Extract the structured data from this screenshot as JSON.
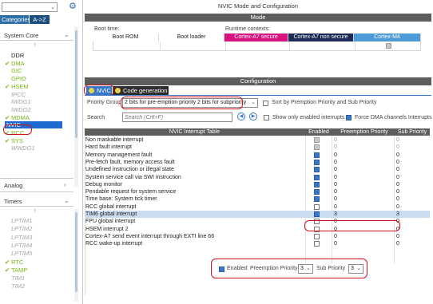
{
  "left": {
    "tabs": {
      "categories": "Categories",
      "az": "A->Z"
    },
    "section_system_core": "System Core",
    "items": [
      {
        "label": "DDR",
        "state": "normal",
        "check": false
      },
      {
        "label": "DMA",
        "state": "green",
        "check": true
      },
      {
        "label": "GIC",
        "state": "green",
        "check": false
      },
      {
        "label": "GPIO",
        "state": "green",
        "check": false
      },
      {
        "label": "HSEM",
        "state": "green",
        "check": true
      },
      {
        "label": "IPCC",
        "state": "gray",
        "check": false
      },
      {
        "label": "IWDG1",
        "state": "gray",
        "check": false
      },
      {
        "label": "IWDG2",
        "state": "gray",
        "check": false
      },
      {
        "label": "MDMA",
        "state": "green",
        "check": true
      },
      {
        "label": "NVIC",
        "state": "selected",
        "check": false
      },
      {
        "label": "RCC",
        "state": "green",
        "check": true
      },
      {
        "label": "SYS",
        "state": "green",
        "check": true
      },
      {
        "label": "WWDG1",
        "state": "gray",
        "check": false
      }
    ],
    "section_analog": "Analog",
    "section_timers": "Timers",
    "timers": [
      {
        "label": "LPTIM1",
        "state": "gray",
        "check": false
      },
      {
        "label": "LPTIM2",
        "state": "gray",
        "check": false
      },
      {
        "label": "LPTIM3",
        "state": "gray",
        "check": false
      },
      {
        "label": "LPTIM4",
        "state": "gray",
        "check": false
      },
      {
        "label": "LPTIM5",
        "state": "gray",
        "check": false
      },
      {
        "label": "RTC",
        "state": "green",
        "check": true
      },
      {
        "label": "TAMP",
        "state": "green",
        "check": true
      },
      {
        "label": "TIM1",
        "state": "gray",
        "check": false
      },
      {
        "label": "TIM2",
        "state": "gray",
        "check": false
      }
    ]
  },
  "main": {
    "title": "NVIC Mode and Configuration",
    "mode_header": "Mode",
    "boot_time": "Boot time:",
    "runtime_contexts": "Runtime contexts:",
    "boot_rom": "Boot ROM",
    "boot_loader": "Boot loader",
    "ctx_a7_secure": "Cortex-A7 secure",
    "ctx_a7_nonsecure": "Cortex-A7 non secure",
    "ctx_m4": "Cortex-M4",
    "colors": {
      "secure": "#d8127f",
      "nonsecure": "#1d2a55",
      "m4": "#4d9ad8"
    },
    "config_header": "Configuration",
    "tab_nvic": "NVIC",
    "tab_codegen": "Code generation",
    "priority_group_label": "Priority Group",
    "priority_group_value": "2 bits for pre-emption priority 2 bits for subpriority",
    "sort_label": "Sort by Premption Priority and Sub Priority",
    "search_label": "Search",
    "search_placeholder": "Search (Crtl+F)",
    "show_enabled_label": "Show only enabled interrupts",
    "force_dma_label": "Force DMA channels Interrupts",
    "table": {
      "headers": [
        "NVIC Interrupt Table",
        "Enabled",
        "Preemption Priority",
        "Sub Priority"
      ],
      "rows": [
        {
          "name": "Non maskable interrupt",
          "enabled": "disabled-on",
          "pre": "0",
          "sub": "0",
          "grey": true
        },
        {
          "name": "Hard fault interrupt",
          "enabled": "disabled-on",
          "pre": "0",
          "sub": "0",
          "grey": true
        },
        {
          "name": "Memory management fault",
          "enabled": "on",
          "pre": "0",
          "sub": "0",
          "grey": false
        },
        {
          "name": "Pre-fetch fault, memory access fault",
          "enabled": "on",
          "pre": "0",
          "sub": "0",
          "grey": false
        },
        {
          "name": "Undefined instruction or illegal state",
          "enabled": "on",
          "pre": "0",
          "sub": "0",
          "grey": false
        },
        {
          "name": "System service call via SWI instruction",
          "enabled": "on",
          "pre": "0",
          "sub": "0",
          "grey": false
        },
        {
          "name": "Debug monitor",
          "enabled": "on",
          "pre": "0",
          "sub": "0",
          "grey": false
        },
        {
          "name": "Pendable request for system service",
          "enabled": "on",
          "pre": "0",
          "sub": "0",
          "grey": false
        },
        {
          "name": "Time base: System tick timer",
          "enabled": "on",
          "pre": "0",
          "sub": "0",
          "grey": false
        },
        {
          "name": "RCC global interrupt",
          "enabled": "off",
          "pre": "0",
          "sub": "0",
          "grey": false
        },
        {
          "name": "TIM6 global interrupt",
          "enabled": "on",
          "pre": "3",
          "sub": "3",
          "grey": false,
          "highlight": true
        },
        {
          "name": "FPU global interrupt",
          "enabled": "off",
          "pre": "0",
          "sub": "0",
          "grey": false
        },
        {
          "name": "HSEM interrupt 2",
          "enabled": "off",
          "pre": "0",
          "sub": "0",
          "grey": false
        },
        {
          "name": "Cortex-A7 send event interrupt through EXTI line 66",
          "enabled": "off",
          "pre": "0",
          "sub": "0",
          "grey": false
        },
        {
          "name": "RCC wake-up interrupt",
          "enabled": "off",
          "pre": "0",
          "sub": "0",
          "grey": false
        }
      ]
    },
    "bottom": {
      "enabled_label": "Enabled",
      "preemption_label": "Preemption Priority",
      "preemption_value": "3",
      "sub_label": "Sub Priority",
      "sub_value": "3"
    }
  }
}
